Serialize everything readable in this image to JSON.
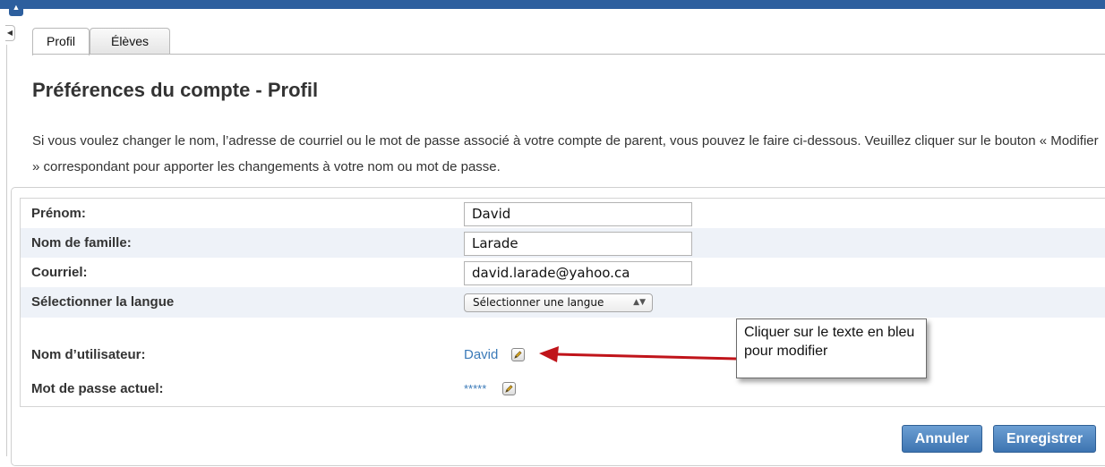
{
  "tabs": [
    {
      "label": "Profil",
      "active": true
    },
    {
      "label": "Élèves",
      "active": false
    }
  ],
  "page_title": "Préférences du compte - Profil",
  "intro_text": "Si vous voulez changer le nom, l’adresse de courriel ou le mot de passe associé à votre compte de parent, vous pouvez le faire ci-dessous. Veuillez cliquer sur le bouton « Modifier » correspondant pour apporter les changements à votre nom ou mot de passe.",
  "form": {
    "first_name": {
      "label": "Prénom:",
      "value": "David"
    },
    "last_name": {
      "label": "Nom de famille:",
      "value": "Larade"
    },
    "email": {
      "label": "Courriel:",
      "value": "david.larade@yahoo.ca"
    },
    "language": {
      "label": "Sélectionner la langue",
      "selected": "Sélectionner une langue"
    },
    "username": {
      "label": "Nom d’utilisateur:",
      "value": "David"
    },
    "password": {
      "label": "Mot de passe actuel:",
      "value": "*****"
    }
  },
  "callout_text": "Cliquer sur le texte en bleu pour modifier",
  "buttons": {
    "cancel": "Annuler",
    "save": "Enregistrer"
  },
  "colors": {
    "accent": "#2d5f9e",
    "link": "#3b7ab8",
    "annotation_arrow": "#c0141a",
    "row_shade": "#eef2f8"
  },
  "icons": {
    "edit": "pencil-edit-icon",
    "collapse": "caret-up-icon",
    "side_toggle": "caret-left-icon"
  }
}
